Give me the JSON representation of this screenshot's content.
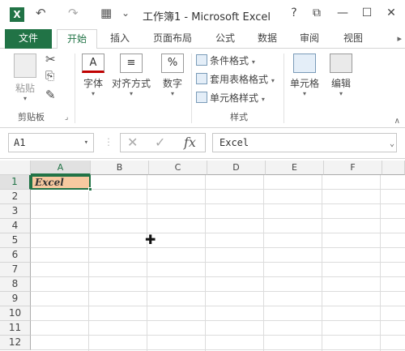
{
  "window": {
    "title": "工作簿1 - Microsoft Excel",
    "app_icon": "excel-logo",
    "app_icon_letter": "X",
    "help": "?",
    "restore": "⧉",
    "minimize": "—",
    "maximize": "☐",
    "close": "✕"
  },
  "quick_access": {
    "undo": "↶",
    "redo": "↷",
    "form": "▦",
    "customize": "⌄"
  },
  "tabs": {
    "file": "文件",
    "items": [
      "开始",
      "插入",
      "页面布局",
      "公式",
      "数据",
      "审阅",
      "视图"
    ],
    "active_index": 0,
    "scroll": "▸"
  },
  "ribbon": {
    "clipboard": {
      "paste": "粘贴",
      "cut": "✂",
      "copy": "⎘",
      "format_painter": "✎",
      "group": "剪贴板",
      "launcher": "⌟"
    },
    "font": {
      "icon_glyph": "A",
      "label": "字体"
    },
    "alignment": {
      "icon_glyph": "≡",
      "label": "对齐方式"
    },
    "number": {
      "icon_glyph": "%",
      "label": "数字"
    },
    "styles": {
      "conditional": "条件格式",
      "table": "套用表格格式",
      "cell": "单元格样式",
      "group": "样式"
    },
    "cells": {
      "label": "单元格"
    },
    "editing": {
      "label": "编辑"
    },
    "dropdown": "▾",
    "collapse": "∧"
  },
  "formula_bar": {
    "name_box": "A1",
    "dropdown": "▾",
    "cancel": "✕",
    "enter": "✓",
    "fx": "fx",
    "value": "Excel",
    "expand": "⌄"
  },
  "sheet": {
    "columns": [
      "A",
      "B",
      "C",
      "D",
      "E",
      "F"
    ],
    "rows": [
      "1",
      "2",
      "3",
      "4",
      "5",
      "6",
      "7",
      "8",
      "9",
      "10",
      "11",
      "12"
    ],
    "selected_cell": "A1",
    "cells": {
      "A1": "Excel"
    },
    "pointer": "✚"
  },
  "colors": {
    "accent": "#217346",
    "selected_fill": "#f7c9a0"
  }
}
